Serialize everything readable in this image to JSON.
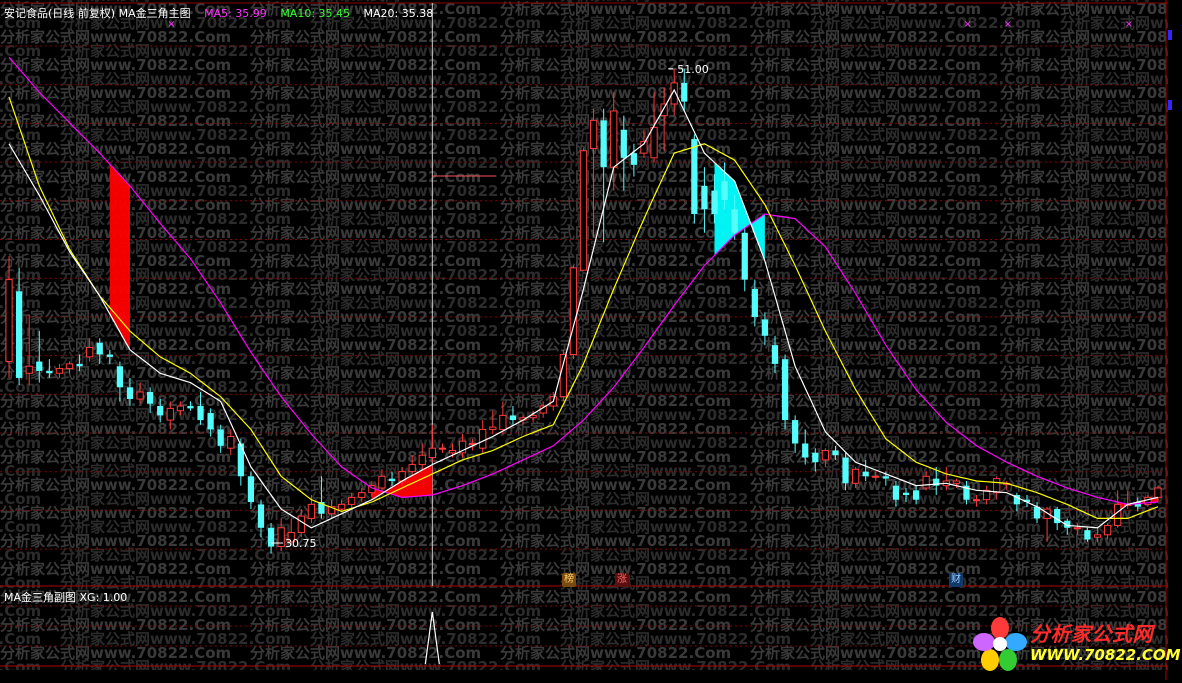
{
  "header": {
    "stock_title": "安记食品(日线 前复权) MA金三角主图",
    "ma5_label": "MA5: 35.99",
    "ma10_label": "MA10: 35.45",
    "ma20_label": "MA20: 35.38"
  },
  "sub_panel": {
    "title": "MA金三角副图 XG: 1.00"
  },
  "annotations": {
    "high_label": "51.00",
    "low_label": "30.75"
  },
  "badges": [
    {
      "text": "榜",
      "color": "#ffcc66",
      "bg": "#7a4a10"
    },
    {
      "text": "涨",
      "color": "#ff6666",
      "bg": "#5a1010"
    },
    {
      "text": "财",
      "color": "#9fd0ff",
      "bg": "#103a6a"
    }
  ],
  "watermark": {
    "line_a": "分析家公式网www.70822.Com",
    "line_b": "分析家公式网www.70822"
  },
  "logo": {
    "title": "分析家公式网",
    "url": "WWW.70822.COM"
  },
  "colors": {
    "up": "#ff3a3a",
    "down": "#54fcfc",
    "ma5": "#ffffff",
    "ma10": "#ffff00",
    "ma20": "#ff00ff",
    "gold_triangle": "#ff0000",
    "death_triangle": "#00ffff",
    "grid": "#8a0000"
  },
  "chart_data": {
    "type": "candlestick",
    "ylim": [
      29,
      53
    ],
    "price_extremes": {
      "high": 51.0,
      "low": 30.75
    },
    "candles": [
      [
        38.5,
        42.0,
        43.0,
        37.8
      ],
      [
        41.5,
        37.8,
        42.5,
        37.5
      ],
      [
        38.0,
        38.3,
        40.5,
        37.5
      ],
      [
        38.5,
        38.1,
        39.8,
        37.6
      ],
      [
        38.1,
        38.0,
        38.6,
        37.8
      ],
      [
        38.0,
        38.2,
        38.4,
        37.8
      ],
      [
        38.2,
        38.4,
        38.5,
        38.0
      ],
      [
        38.4,
        38.3,
        38.8,
        38.1
      ],
      [
        38.7,
        39.1,
        39.5,
        38.5
      ],
      [
        39.3,
        38.8,
        39.5,
        38.4
      ],
      [
        38.8,
        38.7,
        39.0,
        38.4
      ],
      [
        38.3,
        37.4,
        38.5,
        36.8
      ],
      [
        37.4,
        36.9,
        37.8,
        36.6
      ],
      [
        36.9,
        37.2,
        37.6,
        36.7
      ],
      [
        37.2,
        36.7,
        37.4,
        36.3
      ],
      [
        36.6,
        36.2,
        36.9,
        35.9
      ],
      [
        36.0,
        36.5,
        36.8,
        35.6
      ],
      [
        36.4,
        36.6,
        36.8,
        36.2
      ],
      [
        36.6,
        36.5,
        36.8,
        36.4
      ],
      [
        36.6,
        36.0,
        37.2,
        35.8
      ],
      [
        36.3,
        35.6,
        36.5,
        35.3
      ],
      [
        35.6,
        34.9,
        35.8,
        34.6
      ],
      [
        34.8,
        35.3,
        35.6,
        34.5
      ],
      [
        35.0,
        33.6,
        35.2,
        33.2
      ],
      [
        33.6,
        32.5,
        33.8,
        32.2
      ],
      [
        32.4,
        31.4,
        32.6,
        31.0
      ],
      [
        31.4,
        30.6,
        31.6,
        30.3
      ],
      [
        30.6,
        31.4,
        31.8,
        30.4
      ],
      [
        30.8,
        31.2,
        31.8,
        30.7
      ],
      [
        31.2,
        31.9,
        32.2,
        31.0
      ],
      [
        31.8,
        32.4,
        32.8,
        31.6
      ],
      [
        32.5,
        32.0,
        33.6,
        31.8
      ],
      [
        32.0,
        32.3,
        32.6,
        31.8
      ],
      [
        32.2,
        32.4,
        32.6,
        32.1
      ],
      [
        32.4,
        32.7,
        32.9,
        32.2
      ],
      [
        32.7,
        32.9,
        33.1,
        32.5
      ],
      [
        32.9,
        33.2,
        33.4,
        32.7
      ],
      [
        33.1,
        33.6,
        33.9,
        32.9
      ],
      [
        33.5,
        33.4,
        33.8,
        33.2
      ],
      [
        33.4,
        33.8,
        34.0,
        33.2
      ],
      [
        33.8,
        34.1,
        34.5,
        33.6
      ],
      [
        34.1,
        34.5,
        35.0,
        33.9
      ],
      [
        34.4,
        34.8,
        35.8,
        34.2
      ],
      [
        34.8,
        34.8,
        35.0,
        34.6
      ],
      [
        34.6,
        34.7,
        35.0,
        34.4
      ],
      [
        34.6,
        35.1,
        35.4,
        34.4
      ],
      [
        35.0,
        35.0,
        35.2,
        34.7
      ],
      [
        34.8,
        35.6,
        36.0,
        34.6
      ],
      [
        35.6,
        35.7,
        36.4,
        35.4
      ],
      [
        35.6,
        36.2,
        36.8,
        35.4
      ],
      [
        36.2,
        36.0,
        36.6,
        35.8
      ],
      [
        36.0,
        36.1,
        36.2,
        35.8
      ],
      [
        36.1,
        36.2,
        36.4,
        35.9
      ],
      [
        36.3,
        36.6,
        36.8,
        36.1
      ],
      [
        36.6,
        37.0,
        37.2,
        36.4
      ],
      [
        37.0,
        38.8,
        39.0,
        36.8
      ],
      [
        38.8,
        42.5,
        42.6,
        38.6
      ],
      [
        42.4,
        47.5,
        47.6,
        42.4
      ],
      [
        47.6,
        48.8,
        49.3,
        43.8
      ],
      [
        48.8,
        46.8,
        49.3,
        43.6
      ],
      [
        46.8,
        49.2,
        50.0,
        45.8
      ],
      [
        48.4,
        47.2,
        49.0,
        45.8
      ],
      [
        47.4,
        46.9,
        47.8,
        46.4
      ],
      [
        47.4,
        47.9,
        48.4,
        47.2
      ],
      [
        47.2,
        48.5,
        50.0,
        47.0
      ],
      [
        49.0,
        49.5,
        50.2,
        47.5
      ],
      [
        49.5,
        50.4,
        51.0,
        49.0
      ],
      [
        50.4,
        49.6,
        51.0,
        49.2
      ],
      [
        48.0,
        44.8,
        48.2,
        44.4
      ],
      [
        46.0,
        45.0,
        46.8,
        44.0
      ],
      [
        45.8,
        44.8,
        46.5,
        44.4
      ],
      [
        46.2,
        45.4,
        47.0,
        45.0
      ],
      [
        45.0,
        44.0,
        45.6,
        43.7
      ],
      [
        44.0,
        42.0,
        44.3,
        41.5
      ],
      [
        41.6,
        40.4,
        42.0,
        40.0
      ],
      [
        40.3,
        39.6,
        40.6,
        39.2
      ],
      [
        39.2,
        38.4,
        39.6,
        38.0
      ],
      [
        38.6,
        36.0,
        38.8,
        35.6
      ],
      [
        36.0,
        35.0,
        36.2,
        34.6
      ],
      [
        35.0,
        34.4,
        35.6,
        34.1
      ],
      [
        34.6,
        34.2,
        34.8,
        33.8
      ],
      [
        34.3,
        34.7,
        34.8,
        34.0
      ],
      [
        34.7,
        34.5,
        34.9,
        34.3
      ],
      [
        34.4,
        33.3,
        34.6,
        33.0
      ],
      [
        33.3,
        33.9,
        34.0,
        33.1
      ],
      [
        33.8,
        33.6,
        34.3,
        33.4
      ],
      [
        33.6,
        33.6,
        33.8,
        33.4
      ],
      [
        33.6,
        33.5,
        33.8,
        33.2
      ],
      [
        33.2,
        32.6,
        33.4,
        32.3
      ],
      [
        32.9,
        32.8,
        33.1,
        32.5
      ],
      [
        33.0,
        32.6,
        33.2,
        32.4
      ],
      [
        33.1,
        33.6,
        33.8,
        33.0
      ],
      [
        33.5,
        33.2,
        34.0,
        32.8
      ],
      [
        33.2,
        33.4,
        34.0,
        33.0
      ],
      [
        33.3,
        33.4,
        33.5,
        33.1
      ],
      [
        33.2,
        32.6,
        33.4,
        32.4
      ],
      [
        32.6,
        32.6,
        32.8,
        32.3
      ],
      [
        32.6,
        33.0,
        33.2,
        32.4
      ],
      [
        32.9,
        33.5,
        33.6,
        32.6
      ],
      [
        33.3,
        33.3,
        33.4,
        33.0
      ],
      [
        32.8,
        32.4,
        32.9,
        32.1
      ],
      [
        32.6,
        32.5,
        32.8,
        32.3
      ],
      [
        32.3,
        31.8,
        32.5,
        31.6
      ],
      [
        31.8,
        32.2,
        32.3,
        30.8
      ],
      [
        32.2,
        31.6,
        32.3,
        31.3
      ],
      [
        31.7,
        31.4,
        31.8,
        31.1
      ],
      [
        31.4,
        31.4,
        31.6,
        31.1
      ],
      [
        31.3,
        30.9,
        31.4,
        30.8
      ],
      [
        31.0,
        31.1,
        31.4,
        30.8
      ],
      [
        31.1,
        31.5,
        31.6,
        30.9
      ],
      [
        31.5,
        32.4,
        33.0,
        31.4
      ],
      [
        32.4,
        32.4,
        33.0,
        32.2
      ],
      [
        32.5,
        32.3,
        32.7,
        32.1
      ],
      [
        32.4,
        32.7,
        32.8,
        32.3
      ],
      [
        32.7,
        33.1,
        33.2,
        32.5
      ]
    ],
    "ma5": [
      {
        "x": 0,
        "y": 47.8
      },
      {
        "x": 3,
        "y": 45.6
      },
      {
        "x": 6,
        "y": 43.2
      },
      {
        "x": 9,
        "y": 41.3
      },
      {
        "x": 12,
        "y": 39.0
      },
      {
        "x": 15,
        "y": 38.0
      },
      {
        "x": 18,
        "y": 37.6
      },
      {
        "x": 21,
        "y": 36.8
      },
      {
        "x": 24,
        "y": 34.0
      },
      {
        "x": 27,
        "y": 32.2
      },
      {
        "x": 30,
        "y": 31.4
      },
      {
        "x": 33,
        "y": 32.0
      },
      {
        "x": 36,
        "y": 32.6
      },
      {
        "x": 39,
        "y": 33.4
      },
      {
        "x": 42,
        "y": 34.1
      },
      {
        "x": 45,
        "y": 34.7
      },
      {
        "x": 48,
        "y": 35.3
      },
      {
        "x": 51,
        "y": 36.0
      },
      {
        "x": 54,
        "y": 36.8
      },
      {
        "x": 57,
        "y": 41.6
      },
      {
        "x": 60,
        "y": 46.8
      },
      {
        "x": 63,
        "y": 47.8
      },
      {
        "x": 66,
        "y": 50.1
      },
      {
        "x": 69,
        "y": 47.4
      },
      {
        "x": 72,
        "y": 46.2
      },
      {
        "x": 75,
        "y": 42.8
      },
      {
        "x": 78,
        "y": 38.3
      },
      {
        "x": 81,
        "y": 35.5
      },
      {
        "x": 84,
        "y": 34.2
      },
      {
        "x": 87,
        "y": 33.7
      },
      {
        "x": 90,
        "y": 33.2
      },
      {
        "x": 93,
        "y": 33.3
      },
      {
        "x": 96,
        "y": 33.0
      },
      {
        "x": 99,
        "y": 32.9
      },
      {
        "x": 102,
        "y": 32.3
      },
      {
        "x": 105,
        "y": 31.5
      },
      {
        "x": 108,
        "y": 31.4
      },
      {
        "x": 111,
        "y": 32.4
      },
      {
        "x": 114,
        "y": 32.7
      }
    ],
    "ma10": [
      {
        "x": 0,
        "y": 49.8
      },
      {
        "x": 3,
        "y": 46.0
      },
      {
        "x": 6,
        "y": 43.3
      },
      {
        "x": 9,
        "y": 41.3
      },
      {
        "x": 12,
        "y": 39.8
      },
      {
        "x": 15,
        "y": 38.7
      },
      {
        "x": 18,
        "y": 38.0
      },
      {
        "x": 21,
        "y": 37.0
      },
      {
        "x": 24,
        "y": 35.6
      },
      {
        "x": 27,
        "y": 33.6
      },
      {
        "x": 30,
        "y": 32.6
      },
      {
        "x": 33,
        "y": 32.1
      },
      {
        "x": 36,
        "y": 32.5
      },
      {
        "x": 39,
        "y": 33.1
      },
      {
        "x": 42,
        "y": 33.7
      },
      {
        "x": 45,
        "y": 34.3
      },
      {
        "x": 48,
        "y": 34.7
      },
      {
        "x": 51,
        "y": 35.3
      },
      {
        "x": 54,
        "y": 35.8
      },
      {
        "x": 57,
        "y": 38.4
      },
      {
        "x": 60,
        "y": 41.6
      },
      {
        "x": 63,
        "y": 44.6
      },
      {
        "x": 66,
        "y": 47.4
      },
      {
        "x": 69,
        "y": 47.8
      },
      {
        "x": 72,
        "y": 47.1
      },
      {
        "x": 75,
        "y": 45.2
      },
      {
        "x": 78,
        "y": 42.6
      },
      {
        "x": 81,
        "y": 39.8
      },
      {
        "x": 84,
        "y": 37.3
      },
      {
        "x": 87,
        "y": 35.2
      },
      {
        "x": 90,
        "y": 34.2
      },
      {
        "x": 93,
        "y": 33.7
      },
      {
        "x": 96,
        "y": 33.4
      },
      {
        "x": 99,
        "y": 33.3
      },
      {
        "x": 102,
        "y": 32.9
      },
      {
        "x": 105,
        "y": 32.4
      },
      {
        "x": 108,
        "y": 31.8
      },
      {
        "x": 111,
        "y": 31.8
      },
      {
        "x": 114,
        "y": 32.3
      }
    ],
    "ma20": [
      {
        "x": 0,
        "y": 51.5
      },
      {
        "x": 3,
        "y": 50.0
      },
      {
        "x": 6,
        "y": 48.7
      },
      {
        "x": 9,
        "y": 47.4
      },
      {
        "x": 12,
        "y": 46.0
      },
      {
        "x": 15,
        "y": 44.4
      },
      {
        "x": 18,
        "y": 42.9
      },
      {
        "x": 21,
        "y": 41.0
      },
      {
        "x": 24,
        "y": 38.9
      },
      {
        "x": 27,
        "y": 37.0
      },
      {
        "x": 30,
        "y": 35.4
      },
      {
        "x": 33,
        "y": 34.0
      },
      {
        "x": 36,
        "y": 33.1
      },
      {
        "x": 39,
        "y": 32.7
      },
      {
        "x": 42,
        "y": 32.8
      },
      {
        "x": 45,
        "y": 33.2
      },
      {
        "x": 48,
        "y": 33.7
      },
      {
        "x": 51,
        "y": 34.3
      },
      {
        "x": 54,
        "y": 34.9
      },
      {
        "x": 57,
        "y": 36.0
      },
      {
        "x": 60,
        "y": 37.4
      },
      {
        "x": 63,
        "y": 39.1
      },
      {
        "x": 66,
        "y": 40.9
      },
      {
        "x": 69,
        "y": 42.6
      },
      {
        "x": 72,
        "y": 43.9
      },
      {
        "x": 75,
        "y": 44.8
      },
      {
        "x": 78,
        "y": 44.6
      },
      {
        "x": 81,
        "y": 43.4
      },
      {
        "x": 84,
        "y": 41.4
      },
      {
        "x": 87,
        "y": 39.2
      },
      {
        "x": 90,
        "y": 37.3
      },
      {
        "x": 93,
        "y": 35.9
      },
      {
        "x": 96,
        "y": 34.9
      },
      {
        "x": 99,
        "y": 34.2
      },
      {
        "x": 102,
        "y": 33.6
      },
      {
        "x": 105,
        "y": 33.1
      },
      {
        "x": 108,
        "y": 32.7
      },
      {
        "x": 111,
        "y": 32.4
      },
      {
        "x": 114,
        "y": 32.5
      }
    ],
    "gold_triangles_x": [
      [
        10,
        12
      ],
      [
        36,
        42
      ],
      [
        110,
        114
      ]
    ],
    "death_triangles_x": [
      [
        70,
        75
      ]
    ],
    "cross_markers_x": [
      16,
      95,
      99,
      111
    ],
    "signal_x": 42
  }
}
